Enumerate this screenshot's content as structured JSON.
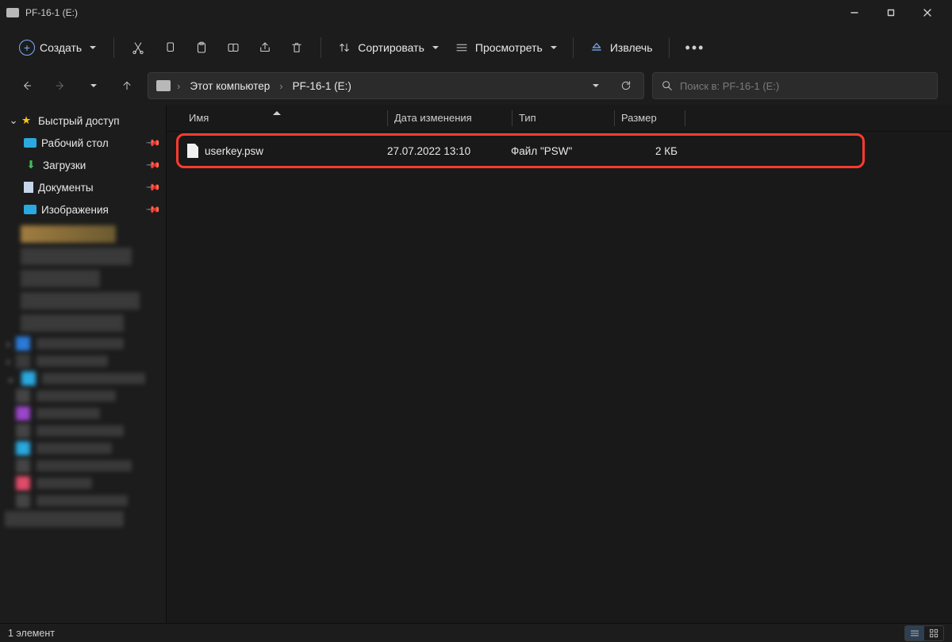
{
  "window": {
    "title": "PF-16-1 (E:)"
  },
  "toolbar": {
    "create_label": "Создать",
    "sort_label": "Сортировать",
    "view_label": "Просмотреть",
    "eject_label": "Извлечь"
  },
  "breadcrumbs": {
    "root": "Этот компьютер",
    "current": "PF-16-1 (E:)"
  },
  "search": {
    "placeholder": "Поиск в: PF-16-1 (E:)"
  },
  "sidebar": {
    "quick_access": "Быстрый доступ",
    "items": [
      {
        "label": "Рабочий стол"
      },
      {
        "label": "Загрузки"
      },
      {
        "label": "Документы"
      },
      {
        "label": "Изображения"
      }
    ]
  },
  "columns": {
    "name": "Имя",
    "date": "Дата изменения",
    "type": "Тип",
    "size": "Размер"
  },
  "files": [
    {
      "name": "userkey.psw",
      "date": "27.07.2022 13:10",
      "type": "Файл \"PSW\"",
      "size": "2 КБ"
    }
  ],
  "status": {
    "count_label": "1 элемент"
  }
}
